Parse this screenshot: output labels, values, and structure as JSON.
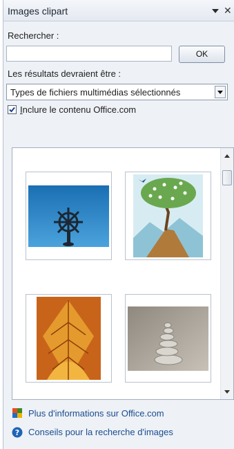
{
  "pane": {
    "title": "Images clipart",
    "menu_icon": "dropdown-triangle-icon",
    "close_icon": "close-icon"
  },
  "search": {
    "label": "Rechercher :",
    "value": "",
    "ok_label": "OK"
  },
  "results_filter": {
    "label": "Les résultats devraient être :",
    "selected": "Types de fichiers multimédias sélectionnés"
  },
  "include_office": {
    "checked": true,
    "label_prefix": "I",
    "label_rest": "nclure le contenu Office.com"
  },
  "results": {
    "items": [
      {
        "name": "ship-wheel-clipart",
        "description": "gouvernail"
      },
      {
        "name": "tree-on-mountain-clipart",
        "description": "arbre"
      },
      {
        "name": "autumn-leaves-clipart",
        "description": "feuilles"
      },
      {
        "name": "stacked-stones-clipart",
        "description": "pierres"
      }
    ]
  },
  "links": {
    "more_info": "Plus d'informations sur Office.com",
    "search_tips": "Conseils pour la recherche d'images"
  }
}
